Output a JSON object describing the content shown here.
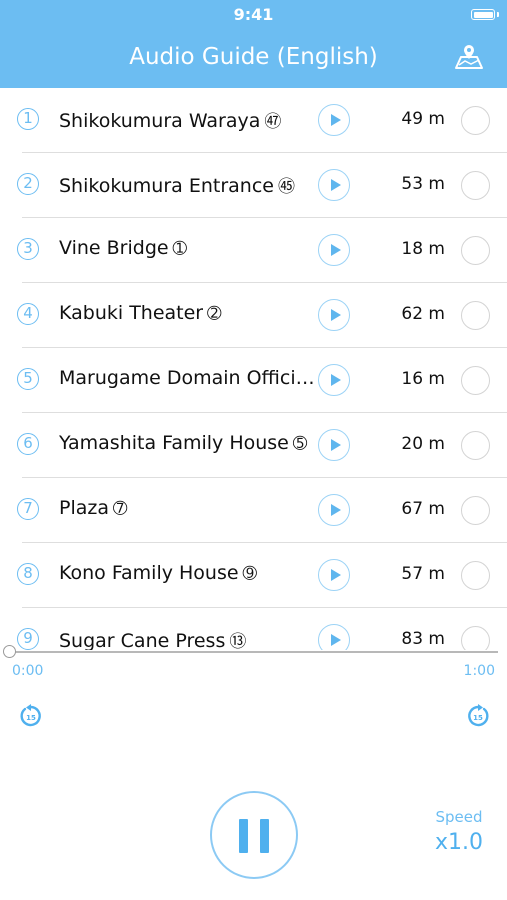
{
  "status_bar": {
    "time": "9:41"
  },
  "header": {
    "title": "Audio Guide (English)",
    "map_icon": "map-icon",
    "background": "#6cbdf2"
  },
  "spots": [
    {
      "number": "1",
      "name": "Shikokumura Waraya",
      "badge": "㊼",
      "distance": "49 m"
    },
    {
      "number": "2",
      "name": "Shikokumura Entrance",
      "badge": "㊺",
      "distance": "53 m"
    },
    {
      "number": "3",
      "name": "Vine Bridge",
      "badge": "➀",
      "distance": "18 m"
    },
    {
      "number": "4",
      "name": "Kabuki Theater",
      "badge": "➁",
      "distance": "62 m"
    },
    {
      "number": "5",
      "name": "Marugame Domain Offici…",
      "badge": "",
      "distance": "16 m"
    },
    {
      "number": "6",
      "name": "Yamashita Family House",
      "badge": "➄",
      "distance": "20 m"
    },
    {
      "number": "7",
      "name": "Plaza",
      "badge": "➆",
      "distance": "67 m"
    },
    {
      "number": "8",
      "name": "Kono Family House",
      "badge": "➈",
      "distance": "57 m"
    },
    {
      "number": "9",
      "name": "Sugar Cane Press",
      "badge": "⑬",
      "distance": "83 m"
    }
  ],
  "player": {
    "elapsed": "0:00",
    "duration": "1:00",
    "progress": 0,
    "speed_label": "Speed",
    "speed_value": "x1.0",
    "skip_seconds": "15",
    "accent": "#6cbdf2"
  }
}
